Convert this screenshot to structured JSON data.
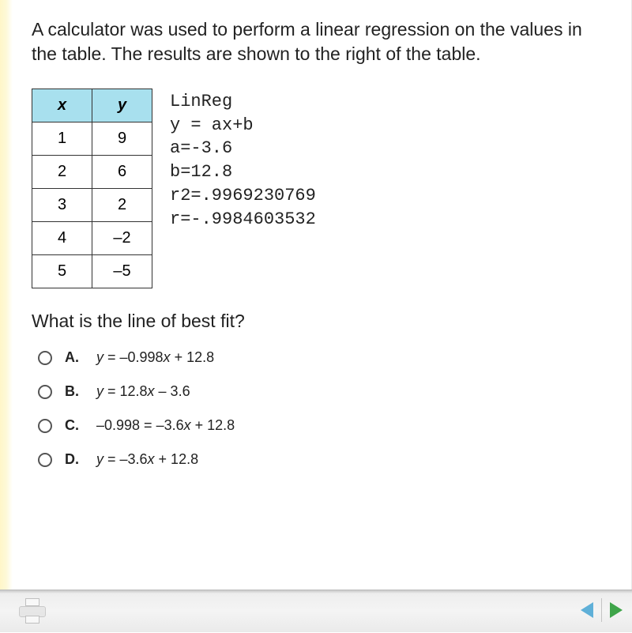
{
  "question": "A calculator was used to perform a linear regression on the values in the table. The results are shown to the right of the table.",
  "table": {
    "headers": {
      "x": "x",
      "y": "y"
    },
    "rows": [
      {
        "x": "1",
        "y": "9"
      },
      {
        "x": "2",
        "y": "6"
      },
      {
        "x": "3",
        "y": "2"
      },
      {
        "x": "4",
        "y": "–2"
      },
      {
        "x": "5",
        "y": "–5"
      }
    ]
  },
  "linreg": {
    "title": "LinReg",
    "eq": "y = ax+b",
    "a": "a=-3.6",
    "b": "b=12.8",
    "r2": "r2=.9969230769",
    "r": "r=-.9984603532"
  },
  "subquestion": "What is the line of best fit?",
  "options": {
    "A": {
      "letter": "A.",
      "html": "<i>y</i> = –0.998<i>x</i> + 12.8"
    },
    "B": {
      "letter": "B.",
      "html": "<i>y</i> = 12.8<i>x</i> – 3.6"
    },
    "C": {
      "letter": "C.",
      "html": "–0.998 = –3.6<i>x</i> + 12.8"
    },
    "D": {
      "letter": "D.",
      "html": "<i>y</i> = –3.6<i>x</i> + 12.8"
    }
  },
  "chart_data": {
    "type": "table",
    "columns": [
      "x",
      "y"
    ],
    "rows": [
      [
        1,
        9
      ],
      [
        2,
        6
      ],
      [
        3,
        2
      ],
      [
        4,
        -2
      ],
      [
        5,
        -5
      ]
    ],
    "linreg": {
      "equation": "y = ax+b",
      "a": -3.6,
      "b": 12.8,
      "r2": 0.9969230769,
      "r": -0.9984603532
    }
  }
}
